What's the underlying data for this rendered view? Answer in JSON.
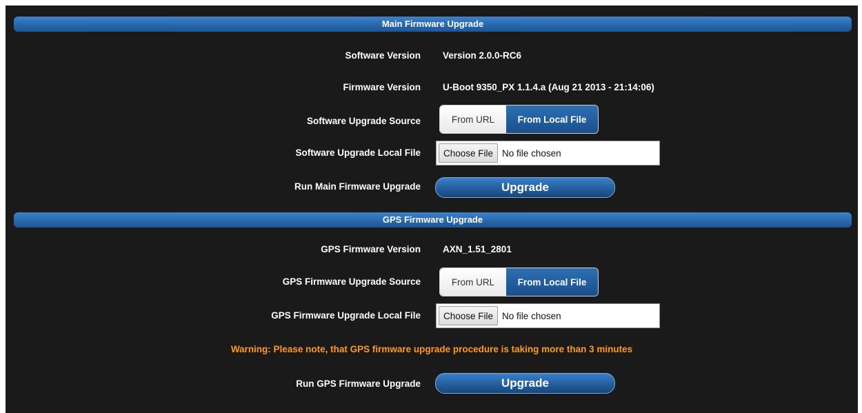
{
  "main": {
    "header": "Main Firmware Upgrade",
    "software_version_label": "Software Version",
    "software_version_value": "Version 2.0.0-RC6",
    "firmware_version_label": "Firmware Version",
    "firmware_version_value": "U-Boot 9350_PX 1.1.4.a (Aug 21 2013 - 21:14:06)",
    "source_label": "Software Upgrade Source",
    "source_option_url": "From URL",
    "source_option_local": "From Local File",
    "local_file_label": "Software Upgrade Local File",
    "choose_file_label": "Choose File",
    "no_file_text": "No file chosen",
    "run_label": "Run Main Firmware Upgrade",
    "upgrade_button": "Upgrade"
  },
  "gps": {
    "header": "GPS Firmware Upgrade",
    "version_label": "GPS Firmware Version",
    "version_value": "AXN_1.51_2801",
    "source_label": "GPS Firmware Upgrade Source",
    "source_option_url": "From URL",
    "source_option_local": "From Local File",
    "local_file_label": "GPS Firmware Upgrade Local File",
    "choose_file_label": "Choose File",
    "no_file_text": "No file chosen",
    "warning": "Warning: Please note, that GPS firmware upgrade procedure is taking more than 3 minutes",
    "run_label": "Run GPS Firmware Upgrade",
    "upgrade_button": "Upgrade"
  },
  "colors": {
    "background": "#1a1a1a",
    "header_blue": "#2a6aae",
    "warning": "#ff9a1f"
  }
}
